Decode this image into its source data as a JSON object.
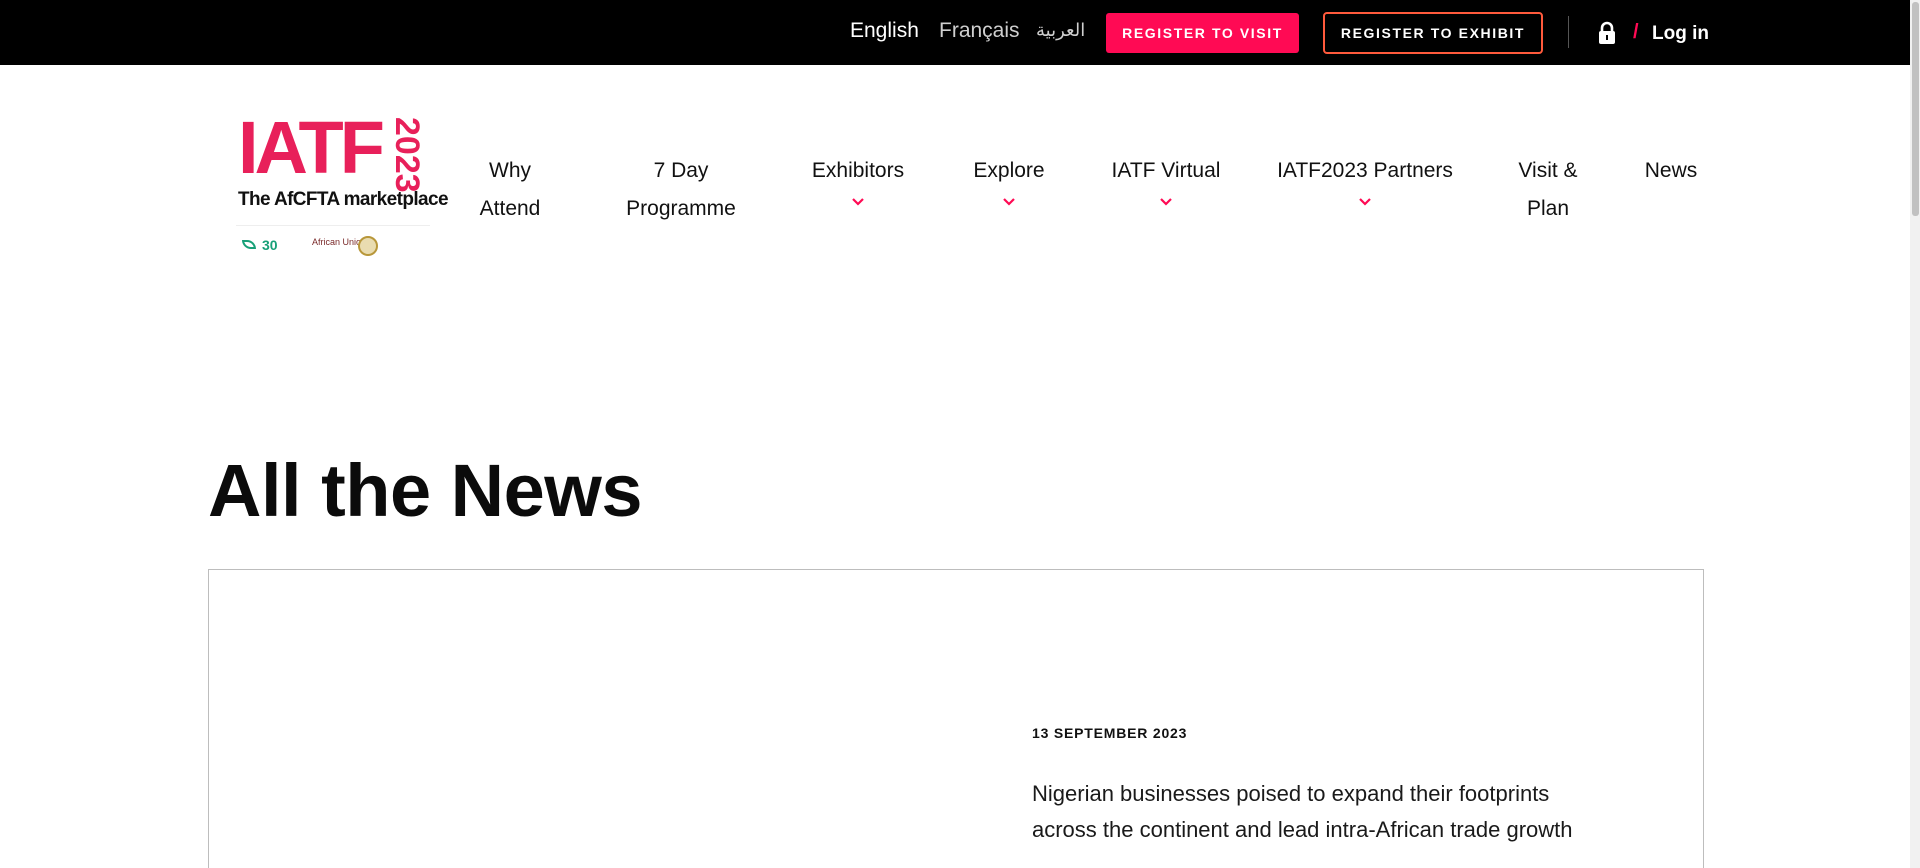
{
  "topbar": {
    "languages": [
      "English",
      "Français",
      "العربية"
    ],
    "register_visit": "REGISTER TO VISIT",
    "register_exhibit": "REGISTER TO EXHIBIT",
    "slash": "/",
    "login": "Log in",
    "icons": [
      "lock-icon"
    ]
  },
  "logo": {
    "brand": "IATF",
    "year": "2023",
    "tagline": "The AfCFTA marketplace",
    "partner_number": "30",
    "partner_text": "African Union"
  },
  "nav": {
    "items": [
      {
        "label": "Why Attend",
        "line1": "Why",
        "line2": "Attend",
        "dropdown": false
      },
      {
        "label": "7 Day Programme",
        "line1": "7 Day",
        "line2": "Programme",
        "dropdown": false
      },
      {
        "label": "Exhibitors",
        "dropdown": true
      },
      {
        "label": "Explore",
        "dropdown": true
      },
      {
        "label": "IATF Virtual",
        "dropdown": true
      },
      {
        "label": "IATF2023 Partners",
        "dropdown": true
      },
      {
        "label": "Visit & Plan",
        "line1": "Visit &",
        "line2": "Plan",
        "dropdown": false
      },
      {
        "label": "News",
        "dropdown": false
      }
    ]
  },
  "main": {
    "title": "All the News",
    "article": {
      "date": "13 SEPTEMBER 2023",
      "headline": "Nigerian businesses poised to expand their footprints across the continent and lead intra-African trade growth"
    }
  },
  "colors": {
    "accent": "#ff0a54",
    "logo_pink": "#e8205a",
    "exhibit_border": "#ff5a3c",
    "topbar_bg": "#000000"
  }
}
